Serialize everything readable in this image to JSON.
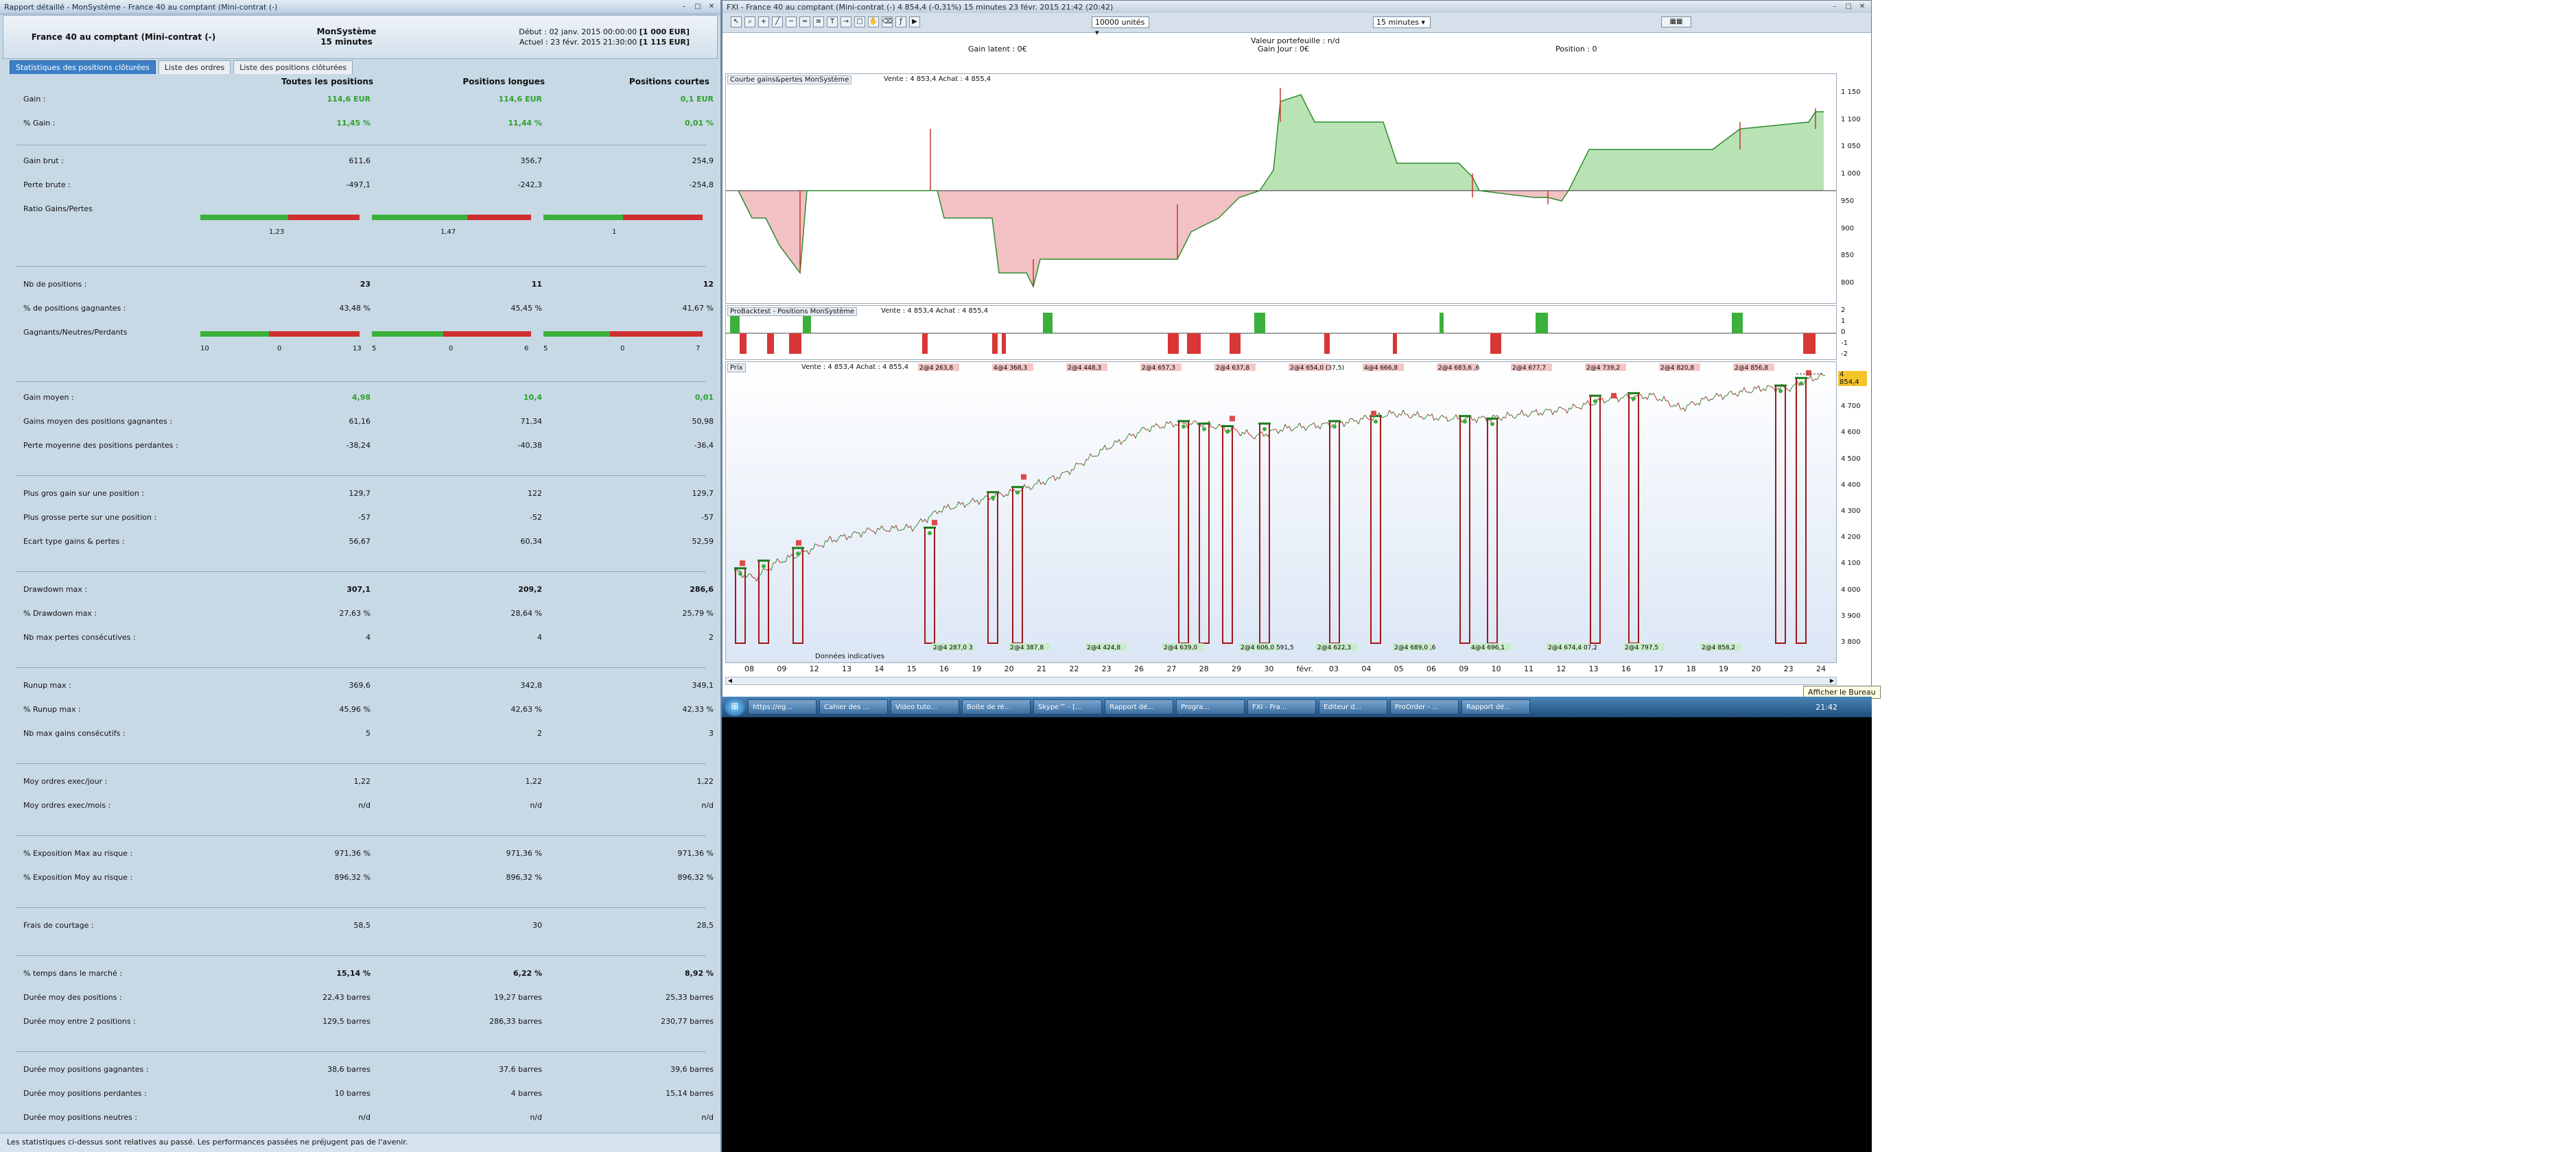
{
  "report": {
    "window_title": "Rapport détaillé - MonSystème - France 40 au comptant (Mini-contrat  (-)",
    "instrument": "France 40 au comptant (Mini-contrat  (-)",
    "system_name": "MonSystème",
    "timeframe": "15 minutes",
    "start_label": "Début : 02 janv. 2015 00:00:00",
    "start_capital": "[1 000 EUR]",
    "current_label": "Actuel : 23 févr. 2015 21:30:00",
    "current_capital": "[1 115 EUR]",
    "tabs": [
      "Statistiques des positions clôturées",
      "Liste des ordres",
      "Liste des positions clôturées"
    ],
    "columns": [
      "Toutes les positions",
      "Positions longues",
      "Positions courtes"
    ],
    "rows": [
      {
        "label": "Gain :",
        "v": [
          "114,6 EUR",
          "114,6 EUR",
          "0,1 EUR"
        ],
        "green": true
      },
      {
        "label": "% Gain :",
        "v": [
          "11,45 %",
          "11,44 %",
          "0,01 %"
        ],
        "green": true
      },
      {
        "label": "Gain brut :",
        "v": [
          "611,6",
          "356,7",
          "254,9"
        ]
      },
      {
        "label": "Perte brute :",
        "v": [
          "-497,1",
          "-242,3",
          "-254,8"
        ]
      },
      {
        "label": "Ratio Gains/Pertes",
        "v": [
          "",
          "",
          ""
        ]
      },
      {
        "label": "Nb de positions :",
        "v": [
          "23",
          "11",
          "12"
        ],
        "bold": true
      },
      {
        "label": "% de positions gagnantes :",
        "v": [
          "43,48 %",
          "45,45 %",
          "41,67 %"
        ]
      },
      {
        "label": "Gagnants/Neutres/Perdants",
        "v": [
          "",
          "",
          ""
        ]
      },
      {
        "label": "Gain moyen :",
        "v": [
          "4,98",
          "10,4",
          "0,01"
        ],
        "green": true
      },
      {
        "label": "Gains moyen des positions gagnantes :",
        "v": [
          "61,16",
          "71,34",
          "50,98"
        ]
      },
      {
        "label": "Perte moyenne des positions perdantes :",
        "v": [
          "-38,24",
          "-40,38",
          "-36,4"
        ]
      },
      {
        "label": "Plus gros gain sur une position :",
        "v": [
          "129,7",
          "122",
          "129,7"
        ]
      },
      {
        "label": "Plus grosse perte sur une position :",
        "v": [
          "-57",
          "-52",
          "-57"
        ]
      },
      {
        "label": "Ecart type gains & pertes :",
        "v": [
          "56,67",
          "60,34",
          "52,59"
        ]
      },
      {
        "label": "Drawdown max :",
        "v": [
          "307,1",
          "209,2",
          "286,6"
        ],
        "bold": true
      },
      {
        "label": "% Drawdown max :",
        "v": [
          "27,63 %",
          "28,64 %",
          "25,79 %"
        ]
      },
      {
        "label": "Nb max pertes consécutives :",
        "v": [
          "4",
          "4",
          "2"
        ]
      },
      {
        "label": "Runup max :",
        "v": [
          "369,6",
          "342,8",
          "349,1"
        ]
      },
      {
        "label": "% Runup max :",
        "v": [
          "45,96 %",
          "42,63 %",
          "42,33 %"
        ]
      },
      {
        "label": "Nb max gains consécutifs :",
        "v": [
          "5",
          "2",
          "3"
        ]
      },
      {
        "label": "Moy ordres exec/jour :",
        "v": [
          "1,22",
          "1,22",
          "1,22"
        ]
      },
      {
        "label": "Moy ordres exec/mois :",
        "v": [
          "n/d",
          "n/d",
          "n/d"
        ]
      },
      {
        "label": "% Exposition Max au risque :",
        "v": [
          "971,36 %",
          "971,36 %",
          "971,36 %"
        ]
      },
      {
        "label": "% Exposition Moy au risque :",
        "v": [
          "896,32 %",
          "896,32 %",
          "896,32 %"
        ]
      },
      {
        "label": "Frais de courtage :",
        "v": [
          "58,5",
          "30",
          "28,5"
        ]
      },
      {
        "label": "% temps dans le marché :",
        "v": [
          "15,14 %",
          "6,22 %",
          "8,92 %"
        ],
        "bold": true
      },
      {
        "label": "Durée moy des positions :",
        "v": [
          "22,43 barres",
          "19,27 barres",
          "25,33 barres"
        ]
      },
      {
        "label": "Durée moy entre 2 positions :",
        "v": [
          "129,5 barres",
          "286,33 barres",
          "230,77 barres"
        ]
      },
      {
        "label": "Durée moy positions gagnantes :",
        "v": [
          "38,6 barres",
          "37,6 barres",
          "39,6 barres"
        ]
      },
      {
        "label": "Durée moy positions perdantes :",
        "v": [
          "10 barres",
          "4 barres",
          "15,14 barres"
        ]
      },
      {
        "label": "Durée moy positions neutres :",
        "v": [
          "n/d",
          "n/d",
          "n/d"
        ]
      }
    ],
    "ratio_gains_pertes": [
      "1,23",
      "1,47",
      "1"
    ],
    "gnp": [
      [
        "10",
        "0",
        "13"
      ],
      [
        "5",
        "0",
        "6"
      ],
      [
        "5",
        "0",
        "7"
      ]
    ],
    "footer": "Les statistiques ci-dessus sont relatives au passé. Les performances passées ne préjugent pas de l'avenir."
  },
  "chart": {
    "window_title": "FXI - France 40 au comptant (Mini-contrat  (-)   4 854,4 (-0,31%)   15 minutes  23 févr. 2015 21:42 (20:42)",
    "units_select": "10000 unités",
    "timeframe_select": "15 minutes",
    "portfolio_label": "Valeur portefeuille : n/d",
    "gain_latent": "Gain latent : 0€",
    "gain_jour": "Gain Jour : 0€",
    "position": "Position : 0",
    "equity_title": "Courbe gains&pertes MonSystème",
    "equity_info": "Vente : 4 853,4  Achat : 4 855,4",
    "pos_title": "ProBacktest - Positions MonSystème",
    "pos_info": "Vente : 4 853,4  Achat : 4 855,4",
    "price_title": "Prix",
    "price_info": "Vente : 4 853,4  Achat : 4 855,4",
    "equity_axis": [
      "1 150",
      "1 100",
      "1 050",
      "1 000",
      "950",
      "900",
      "850",
      "800"
    ],
    "pos_axis": [
      "2",
      "1",
      "0",
      "-1",
      "-2"
    ],
    "price_axis": [
      "4 800",
      "4 700",
      "4 600",
      "4 500",
      "4 400",
      "4 300",
      "4 200",
      "4 100",
      "4 000",
      "3 900",
      "3 800"
    ],
    "price_badge": "4 854,4",
    "dates": [
      "08",
      "09",
      "12",
      "13",
      "14",
      "15",
      "16",
      "19",
      "20",
      "21",
      "22",
      "23",
      "26",
      "27",
      "28",
      "29",
      "30",
      "févr.",
      "03",
      "04",
      "05",
      "06",
      "09",
      "10",
      "11",
      "12",
      "13",
      "16",
      "17",
      "18",
      "19",
      "20",
      "23",
      "24"
    ],
    "top_trades": [
      "2@4 263,8",
      "4@4 368,3",
      "2@4 448,3",
      "2@4 657,3",
      "2@4 637,8",
      "2@4 654,0 (37,5)",
      "4@4 666,8",
      "2@4 683,6 ,6",
      "2@4 677,7",
      "2@4 739,2",
      "2@4 820,8",
      "2@4 856,8"
    ],
    "bottom_trades": [
      "2@4 287,0 3",
      "2@4 387,8",
      "2@4 424,8",
      "2@4 639,0",
      "2@4 606,0 591,5",
      "2@4 622,3",
      "2@4 689,0 ,6",
      "4@4 696,1",
      "2@4 674,4 07,2",
      "2@4 797,5",
      "2@4 858,2"
    ],
    "note": "Données indicatives",
    "tooltip": "Afficher le Bureau"
  },
  "taskbar": {
    "items": [
      "https://eg...",
      "Cahier des ...",
      "Video tuto...",
      "Boite de ré...",
      "Skype™ - [...",
      "Rapport dé...",
      "Progra...",
      "FXI - Fra...",
      "Editeur d...",
      "ProOrder - ...",
      "Rapport dé..."
    ],
    "clock": "21:42"
  },
  "colors": {
    "green": "#3bb03b",
    "red": "#cf2f2f",
    "accent": "#3d7fc6"
  }
}
